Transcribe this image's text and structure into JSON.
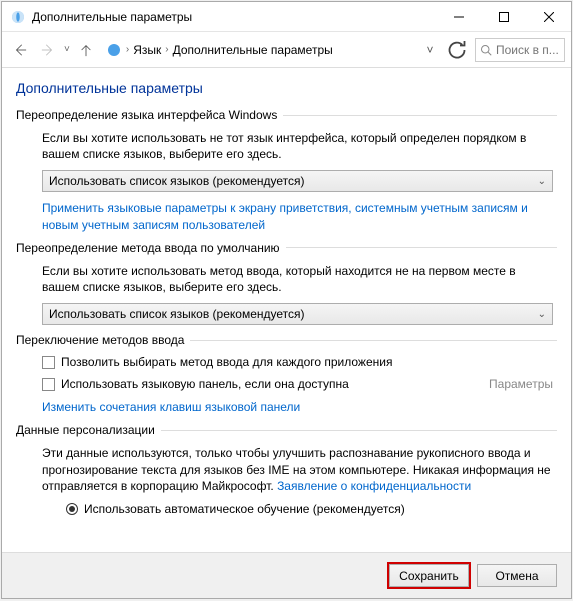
{
  "window": {
    "title": "Дополнительные параметры"
  },
  "nav": {
    "breadcrumb": {
      "item1": "Язык",
      "item2": "Дополнительные параметры"
    },
    "search_placeholder": "Поиск в п..."
  },
  "page": {
    "title": "Дополнительные параметры"
  },
  "group1": {
    "header": "Переопределение языка интерфейса Windows",
    "desc": "Если вы хотите использовать не тот язык интерфейса, который определен порядком в вашем списке языков, выберите его здесь.",
    "dropdown": "Использовать список языков (рекомендуется)",
    "link": "Применить языковые параметры к экрану приветствия, системным учетным записям и новым учетным записям пользователей"
  },
  "group2": {
    "header": "Переопределение метода ввода по умолчанию",
    "desc": "Если вы хотите использовать метод ввода, который находится не на первом месте в вашем списке языков, выберите его здесь.",
    "dropdown": "Использовать список языков (рекомендуется)"
  },
  "group3": {
    "header": "Переключение методов ввода",
    "check1": "Позволить выбирать метод ввода для каждого приложения",
    "check2": "Использовать языковую панель, если она доступна",
    "sidelink": "Параметры",
    "link": "Изменить сочетания клавиш языковой панели"
  },
  "group4": {
    "header": "Данные персонализации",
    "desc_part1": "Эти данные используются, только чтобы улучшить распознавание рукописного ввода и прогнозирование текста для языков без IME на этом компьютере. Никакая информация не отправляется в корпорацию Майкрософт. ",
    "privacy_link": "Заявление о конфиденциальности",
    "radio1": "Использовать автоматическое обучение (рекомендуется)"
  },
  "buttons": {
    "save": "Сохранить",
    "cancel": "Отмена"
  }
}
